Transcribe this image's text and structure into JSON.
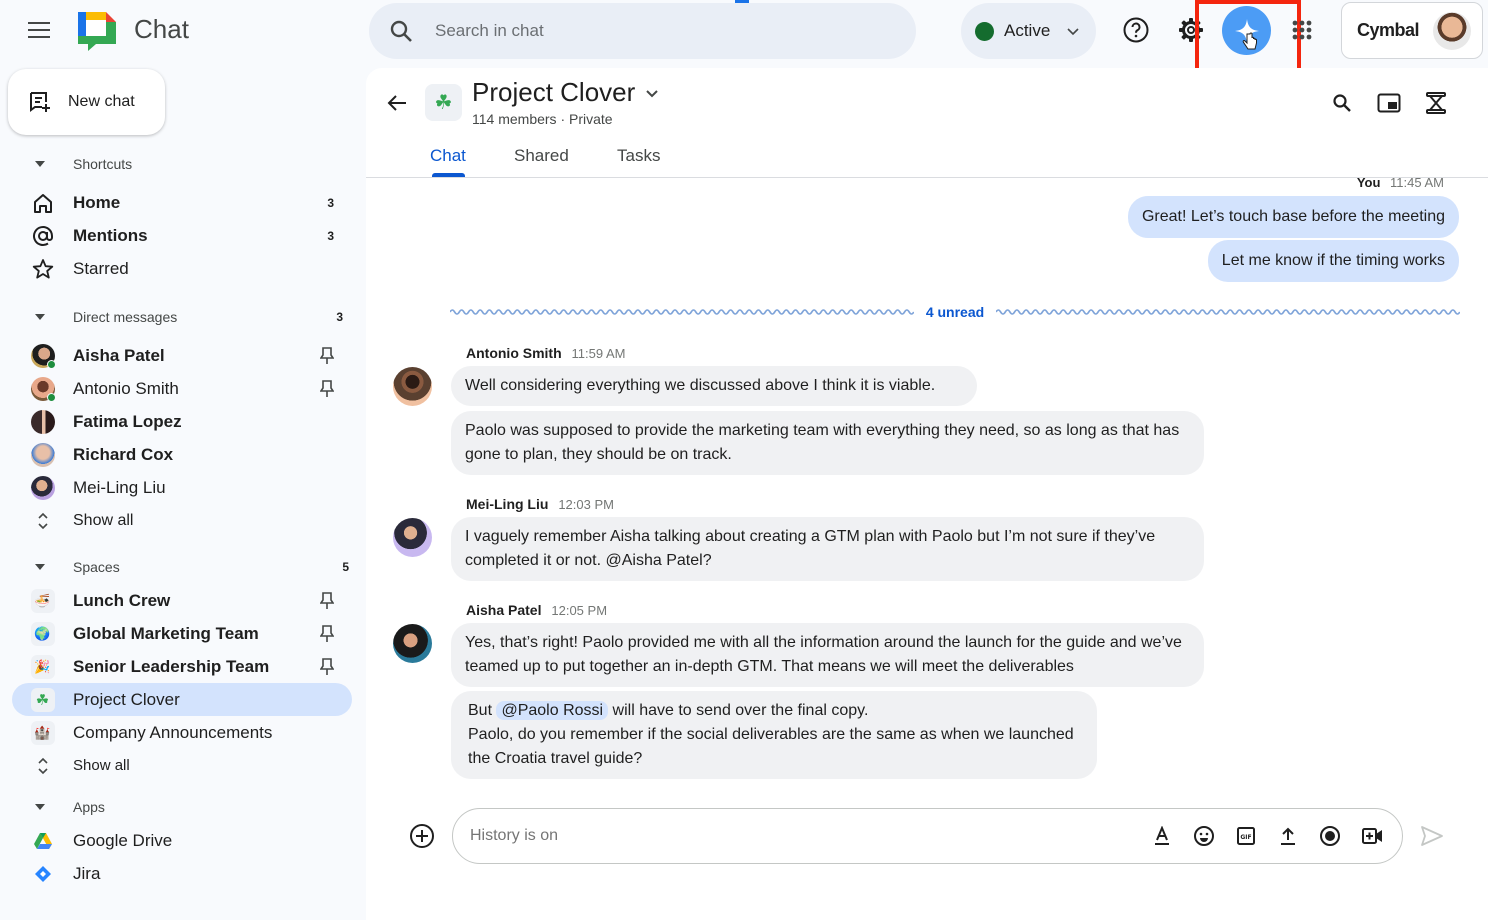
{
  "app": {
    "title": "Chat",
    "search_placeholder": "Search in chat",
    "status": {
      "label": "Active",
      "color": "#146c2e"
    },
    "brand": "Cymbal",
    "accent_color": "#0b57d0",
    "highlight_color": "#f4250e"
  },
  "sidebar": {
    "new_chat_label": "New chat",
    "shortcuts": {
      "label": "Shortcuts",
      "items": [
        {
          "label": "Home",
          "count": "3",
          "bold": true,
          "icon": "home-icon"
        },
        {
          "label": "Mentions",
          "count": "3",
          "bold": true,
          "icon": "at-sign-icon"
        },
        {
          "label": "Starred",
          "count": "",
          "bold": false,
          "icon": "star-icon"
        }
      ]
    },
    "direct_messages": {
      "label": "Direct messages",
      "count": "3",
      "items": [
        {
          "label": "Aisha Patel",
          "bold": true,
          "pinned": true,
          "online": true
        },
        {
          "label": "Antonio Smith",
          "bold": false,
          "pinned": true,
          "online": true
        },
        {
          "label": "Fatima Lopez",
          "bold": true,
          "pinned": false,
          "online": false
        },
        {
          "label": "Richard Cox",
          "bold": true,
          "pinned": false,
          "online": false
        },
        {
          "label": "Mei-Ling Liu",
          "bold": false,
          "pinned": false,
          "online": false
        }
      ],
      "show_all_label": "Show all"
    },
    "spaces": {
      "label": "Spaces",
      "count": "5",
      "items": [
        {
          "label": "Lunch Crew",
          "bold": true,
          "pinned": true,
          "emoji": "🍜",
          "active": false
        },
        {
          "label": "Global Marketing Team",
          "bold": true,
          "pinned": true,
          "emoji": "🌍",
          "active": false
        },
        {
          "label": "Senior Leadership Team",
          "bold": true,
          "pinned": true,
          "emoji": "🎉",
          "active": false
        },
        {
          "label": "Project Clover",
          "bold": false,
          "pinned": false,
          "emoji": "☘",
          "active": true
        },
        {
          "label": "Company Announcements",
          "bold": false,
          "pinned": false,
          "emoji": "🏰",
          "active": false
        }
      ],
      "show_all_label": "Show all"
    },
    "apps": {
      "label": "Apps",
      "items": [
        {
          "label": "Google Drive",
          "icon": "google-drive-icon"
        },
        {
          "label": "Jira",
          "icon": "jira-icon"
        }
      ]
    }
  },
  "room": {
    "title": "Project Clover",
    "emoji": "☘",
    "subtitle": "114 members · Private",
    "tabs": [
      {
        "label": "Chat",
        "active": true
      },
      {
        "label": "Shared",
        "active": false
      },
      {
        "label": "Tasks",
        "active": false
      }
    ]
  },
  "conversation": {
    "self": {
      "sender": "You",
      "time": "11:45 AM",
      "messages": [
        "Great! Let’s touch base before the meeting",
        "Let me know if the timing works"
      ]
    },
    "unread_label": "4 unread",
    "groups": [
      {
        "sender": "Antonio Smith",
        "time": "11:59 AM",
        "messages": [
          "Well considering everything we discussed above I think it is viable.",
          "Paolo was supposed to provide the marketing team with everything they need, so as long as that has gone to plan, they should be on track."
        ]
      },
      {
        "sender": "Mei-Ling Liu",
        "time": "12:03 PM",
        "messages": [
          "I vaguely remember Aisha talking about creating a GTM plan with Paolo but I’m not sure if they’ve completed it or not.  @Aisha Patel?"
        ]
      },
      {
        "sender": "Aisha Patel",
        "time": "12:05 PM",
        "messages": [
          "Yes, that’s right! Paolo provided me with all the information around the launch for the guide and we’ve teamed up to put together an in-depth GTM. That means we will meet the deliverables"
        ],
        "mention_message": {
          "before": "But",
          "mention": "@Paolo Rossi",
          "after": "will have to send over the final copy.",
          "line2": "Paolo, do you remember if the social deliverables are the same as when we launched the Croatia travel guide?"
        }
      }
    ]
  },
  "composer": {
    "placeholder": "History is on",
    "tools": [
      "format-text-icon",
      "emoji-icon",
      "gif-icon",
      "upload-icon",
      "record-icon",
      "video-meeting-icon"
    ]
  }
}
